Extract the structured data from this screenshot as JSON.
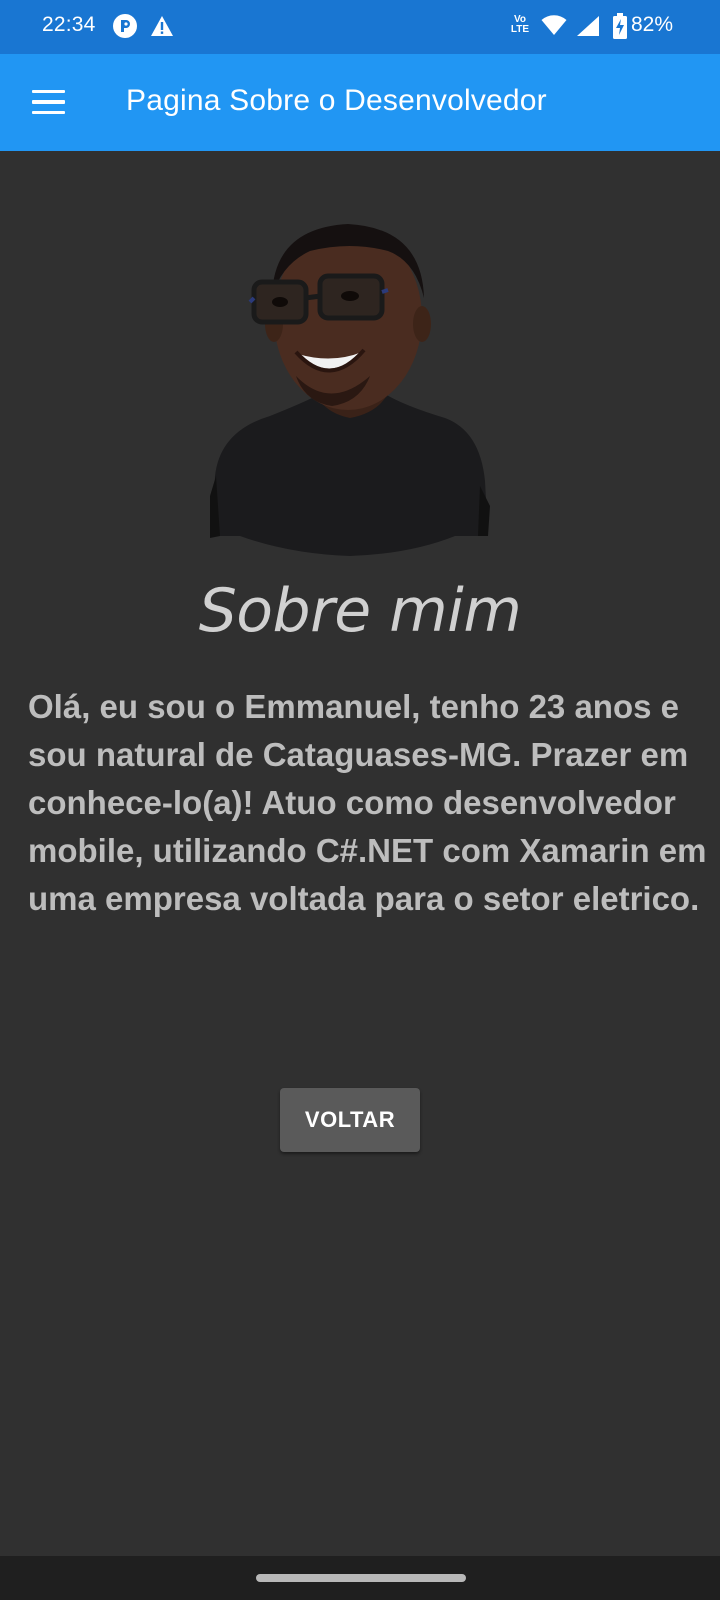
{
  "status_bar": {
    "time": "22:34",
    "network_label": "Vo LTE",
    "battery_percent": "82%",
    "icons": [
      "app-notification-icon",
      "warning-icon",
      "volte-icon",
      "wifi-icon",
      "cell-signal-icon",
      "battery-charging-icon"
    ]
  },
  "app_bar": {
    "title": "Pagina Sobre o Desenvolvedor",
    "menu_icon": "hamburger-menu-icon",
    "color": "#2196F3"
  },
  "main": {
    "section_title": "Sobre mim",
    "bio": "Olá, eu sou o Emmanuel, tenho 23 anos e sou natural de Cataguases-MG. Prazer em conhece-lo(a)! Atuo como desenvolvedor mobile, utilizando C#.NET com Xamarin em uma empresa voltada para o setor eletrico.",
    "back_button": "VOLTAR",
    "background": "#303030"
  }
}
